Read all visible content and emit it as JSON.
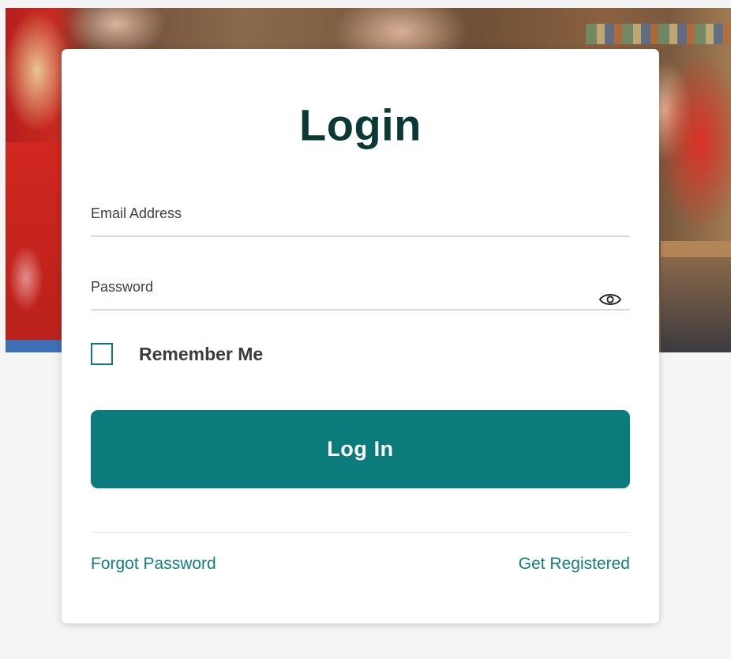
{
  "login": {
    "title": "Login",
    "email_label": "Email Address",
    "password_label": "Password",
    "password_toggle_icon": "eye-icon",
    "remember_label": "Remember Me",
    "remember_checked": false,
    "submit_label": "Log In",
    "forgot_label": "Forgot Password",
    "register_label": "Get Registered"
  },
  "colors": {
    "accent": "#0c7b7c",
    "title": "#0b3a36",
    "link": "#137f7d"
  }
}
